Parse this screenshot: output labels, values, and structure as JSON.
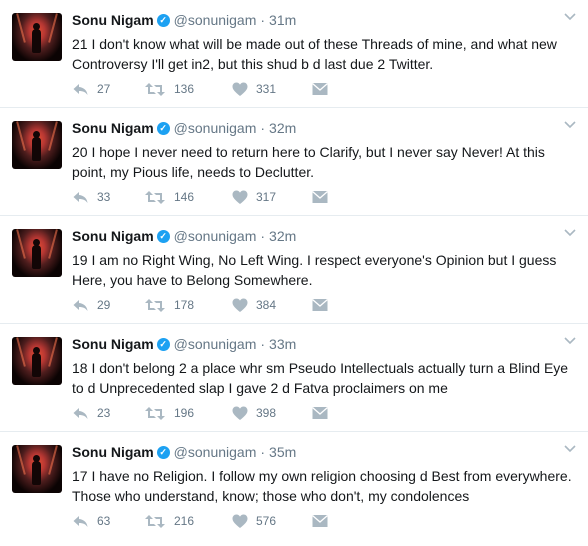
{
  "colors": {
    "accent": "#1da1f2",
    "text": "#14171a",
    "muted": "#657786",
    "icon": "#aab8c2",
    "divider": "#e6ecf0"
  },
  "icons": {
    "verified": "verified-badge-icon",
    "caret": "chevron-down-icon",
    "reply": "reply-icon",
    "retweet": "retweet-icon",
    "like": "heart-icon",
    "message": "direct-message-icon"
  },
  "tweets": [
    {
      "name": "Sonu Nigam",
      "verified_glyph": "✓",
      "handle": "@sonunigam",
      "dot": "·",
      "time": "31m",
      "text": "21 I don't know what will be made out of these Threads of mine, and what new Controversy I'll get in2, but this shud b d last due 2 Twitter.",
      "replies": "27",
      "retweets": "136",
      "likes": "331"
    },
    {
      "name": "Sonu Nigam",
      "verified_glyph": "✓",
      "handle": "@sonunigam",
      "dot": "·",
      "time": "32m",
      "text": "20 I hope I never need to return here to Clarify, but I never say Never! At this point, my Pious life, needs to Declutter.",
      "replies": "33",
      "retweets": "146",
      "likes": "317"
    },
    {
      "name": "Sonu Nigam",
      "verified_glyph": "✓",
      "handle": "@sonunigam",
      "dot": "·",
      "time": "32m",
      "text": "19 I am no Right Wing, No Left Wing. I respect everyone's Opinion but I guess Here, you have to Belong Somewhere.",
      "replies": "29",
      "retweets": "178",
      "likes": "384"
    },
    {
      "name": "Sonu Nigam",
      "verified_glyph": "✓",
      "handle": "@sonunigam",
      "dot": "·",
      "time": "33m",
      "text": "18 I don't belong 2 a place whr sm Pseudo Intellectuals actually turn a Blind Eye to d Unprecedented slap I gave 2 d Fatva proclaimers on me",
      "replies": "23",
      "retweets": "196",
      "likes": "398"
    },
    {
      "name": "Sonu Nigam",
      "verified_glyph": "✓",
      "handle": "@sonunigam",
      "dot": "·",
      "time": "35m",
      "text": "17 I have no Religion. I follow my own religion choosing d Best from everywhere. Those who understand, know; those who don't, my condolences",
      "replies": "63",
      "retweets": "216",
      "likes": "576"
    }
  ]
}
